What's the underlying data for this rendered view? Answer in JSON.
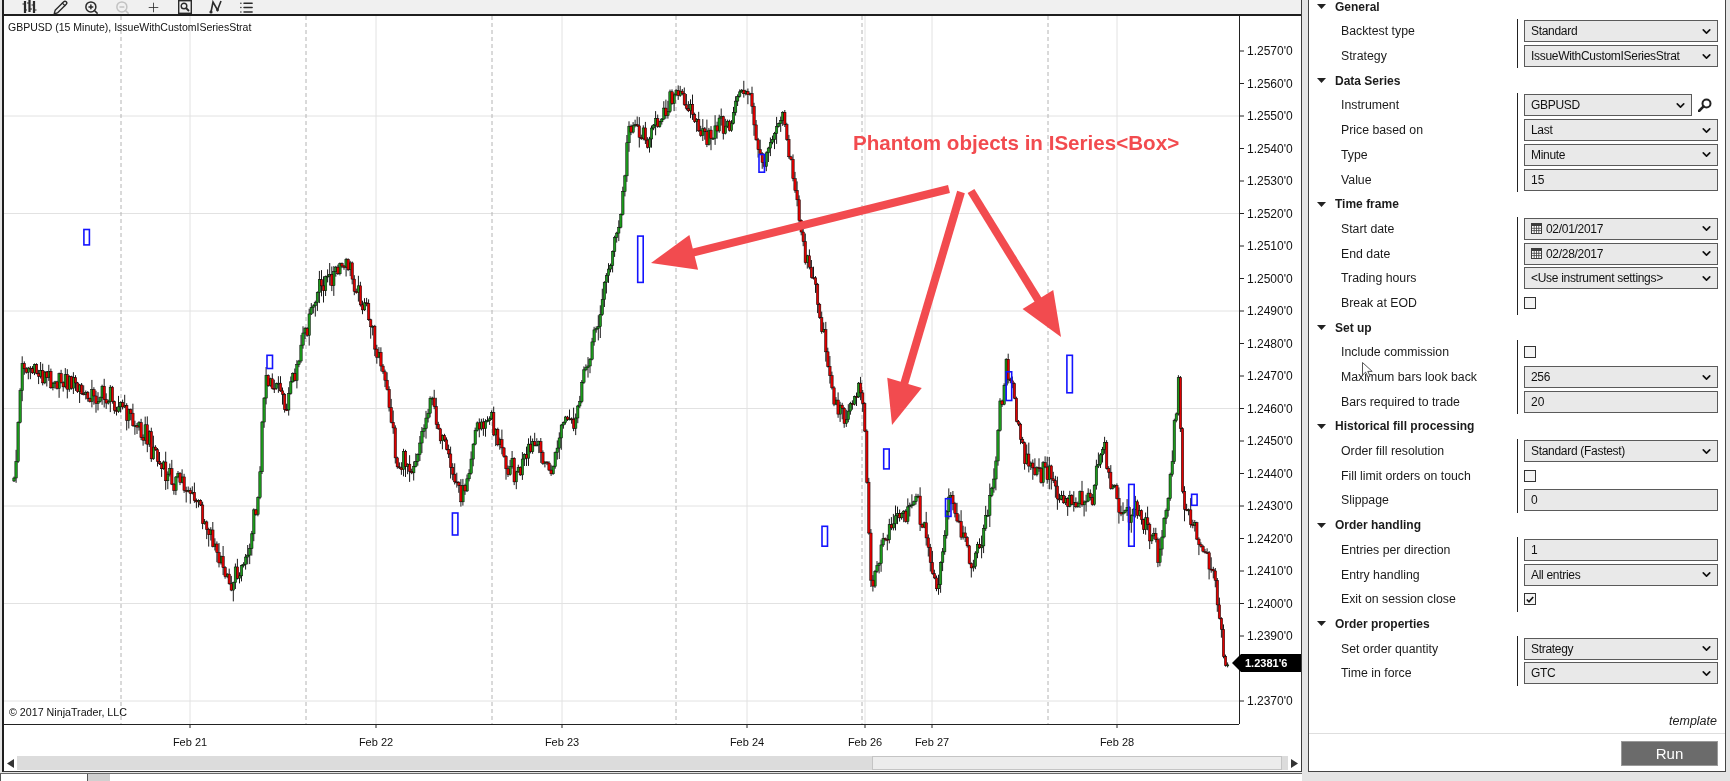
{
  "chart_window": {
    "toolbar": [
      {
        "kind": "chart-style",
        "disabled": false
      },
      {
        "kind": "draw",
        "disabled": false
      },
      {
        "kind": "zoom-in",
        "disabled": false
      },
      {
        "kind": "zoom-out",
        "disabled": true
      },
      {
        "kind": "crosshair",
        "disabled": false
      },
      {
        "kind": "data-box",
        "disabled": false
      },
      {
        "kind": "drawing-tools",
        "disabled": false
      },
      {
        "kind": "properties",
        "disabled": false
      }
    ],
    "title": "GBPUSD (15 Minute), IssueWithCustomISeriesStrat",
    "annotation": "Phantom objects in ISeries<Box>",
    "copyright": "© 2017 NinjaTrader, LLC",
    "price_axis": [
      "1.2570'0",
      "1.2560'0",
      "1.2550'0",
      "1.2540'0",
      "1.2530'0",
      "1.2520'0",
      "1.2510'0",
      "1.2500'0",
      "1.2490'0",
      "1.2480'0",
      "1.2470'0",
      "1.2460'0",
      "1.2450'0",
      "1.2440'0",
      "1.2430'0",
      "1.2420'0",
      "1.2410'0",
      "1.2400'0",
      "1.2390'0",
      "1.2370'0"
    ],
    "current_price": "1.2381'6",
    "time_axis": [
      "Feb 21",
      "Feb 22",
      "Feb 23",
      "Feb 24",
      "Feb 26",
      "Feb 27",
      "Feb 28"
    ]
  },
  "strategy_properties": {
    "sections": [
      {
        "title": "General",
        "expanded": true,
        "rows": [
          {
            "label": "Backtest type",
            "kind": "dropdown",
            "value": "Standard"
          },
          {
            "label": "Strategy",
            "kind": "dropdown",
            "value": "IssueWithCustomISeriesStrat"
          }
        ]
      },
      {
        "title": "Data Series",
        "expanded": true,
        "rows": [
          {
            "label": "Instrument",
            "kind": "lookup",
            "value": "GBPUSD"
          },
          {
            "label": "Price based on",
            "kind": "dropdown",
            "value": "Last"
          },
          {
            "label": "Type",
            "kind": "dropdown",
            "value": "Minute"
          },
          {
            "label": "Value",
            "kind": "text",
            "value": "15"
          }
        ]
      },
      {
        "title": "Time frame",
        "expanded": true,
        "rows": [
          {
            "label": "Start date",
            "kind": "date",
            "value": "02/01/2017"
          },
          {
            "label": "End date",
            "kind": "date",
            "value": "02/28/2017"
          },
          {
            "label": "Trading hours",
            "kind": "dropdown",
            "value": "<Use instrument settings>"
          },
          {
            "label": "Break at EOD",
            "kind": "checkbox",
            "checked": false
          }
        ]
      },
      {
        "title": "Set up",
        "expanded": true,
        "rows": [
          {
            "label": "Include commission",
            "kind": "checkbox",
            "checked": false
          },
          {
            "label": "Maximum bars look back",
            "kind": "dropdown",
            "value": "256"
          },
          {
            "label": "Bars required to trade",
            "kind": "text",
            "value": "20"
          }
        ]
      },
      {
        "title": "Historical fill processing",
        "expanded": true,
        "rows": [
          {
            "label": "Order fill resolution",
            "kind": "dropdown",
            "value": "Standard (Fastest)"
          },
          {
            "label": "Fill limit orders on touch",
            "kind": "checkbox",
            "checked": false
          },
          {
            "label": "Slippage",
            "kind": "text",
            "value": "0"
          }
        ]
      },
      {
        "title": "Order handling",
        "expanded": true,
        "rows": [
          {
            "label": "Entries per direction",
            "kind": "text",
            "value": "1"
          },
          {
            "label": "Entry handling",
            "kind": "dropdown",
            "value": "All entries"
          },
          {
            "label": "Exit on session close",
            "kind": "checkbox",
            "checked": true
          }
        ]
      },
      {
        "title": "Order properties",
        "expanded": true,
        "rows": [
          {
            "label": "Set order quantity",
            "kind": "dropdown",
            "value": "Strategy"
          },
          {
            "label": "Time in force",
            "kind": "dropdown",
            "value": "GTC"
          }
        ]
      }
    ],
    "template_link": "template",
    "run_button": "Run"
  }
}
